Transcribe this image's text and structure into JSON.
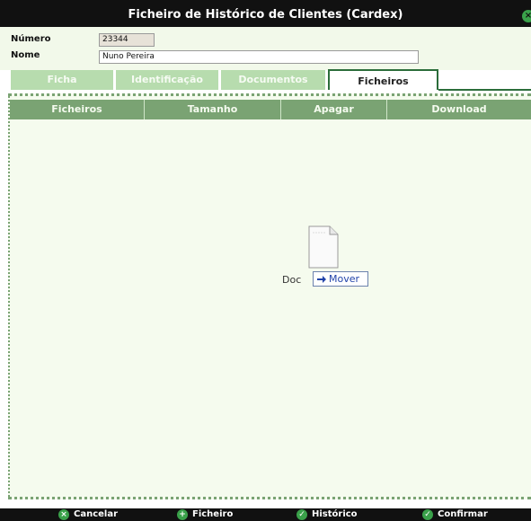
{
  "window": {
    "title": "Ficheiro de Histórico de Clientes (Cardex)",
    "close_icon": "close-circle-icon"
  },
  "form": {
    "numero_label": "Número",
    "numero_value": "23344",
    "nome_label": "Nome",
    "nome_value": "Nuno Pereira"
  },
  "tabs": [
    {
      "label": "Ficha"
    },
    {
      "label": "Identificação"
    },
    {
      "label": "Documentos"
    },
    {
      "label": "Ficheiros"
    }
  ],
  "table": {
    "headers": [
      "Ficheiros",
      "Tamanho",
      "Apagar",
      "Download"
    ]
  },
  "drag": {
    "doc_label": "Doc",
    "mover_label": "Mover",
    "doc_icon": "document-icon",
    "mover_icon": "arrow-right-icon"
  },
  "footer": {
    "buttons": [
      {
        "label": "Cancelar",
        "icon": "cancel-icon"
      },
      {
        "label": "Ficheiro",
        "icon": "add-icon"
      },
      {
        "label": "Histórico",
        "icon": "check-icon"
      },
      {
        "label": "Confirmar",
        "icon": "check-icon"
      }
    ]
  },
  "colors": {
    "titlebar": "#111111",
    "tab_inactive": "#b7dcae",
    "tab_active_border": "#2b6d3a",
    "table_header": "#7aa373",
    "panel_bg": "#f5fbee",
    "accent_green": "#3aa14a"
  }
}
